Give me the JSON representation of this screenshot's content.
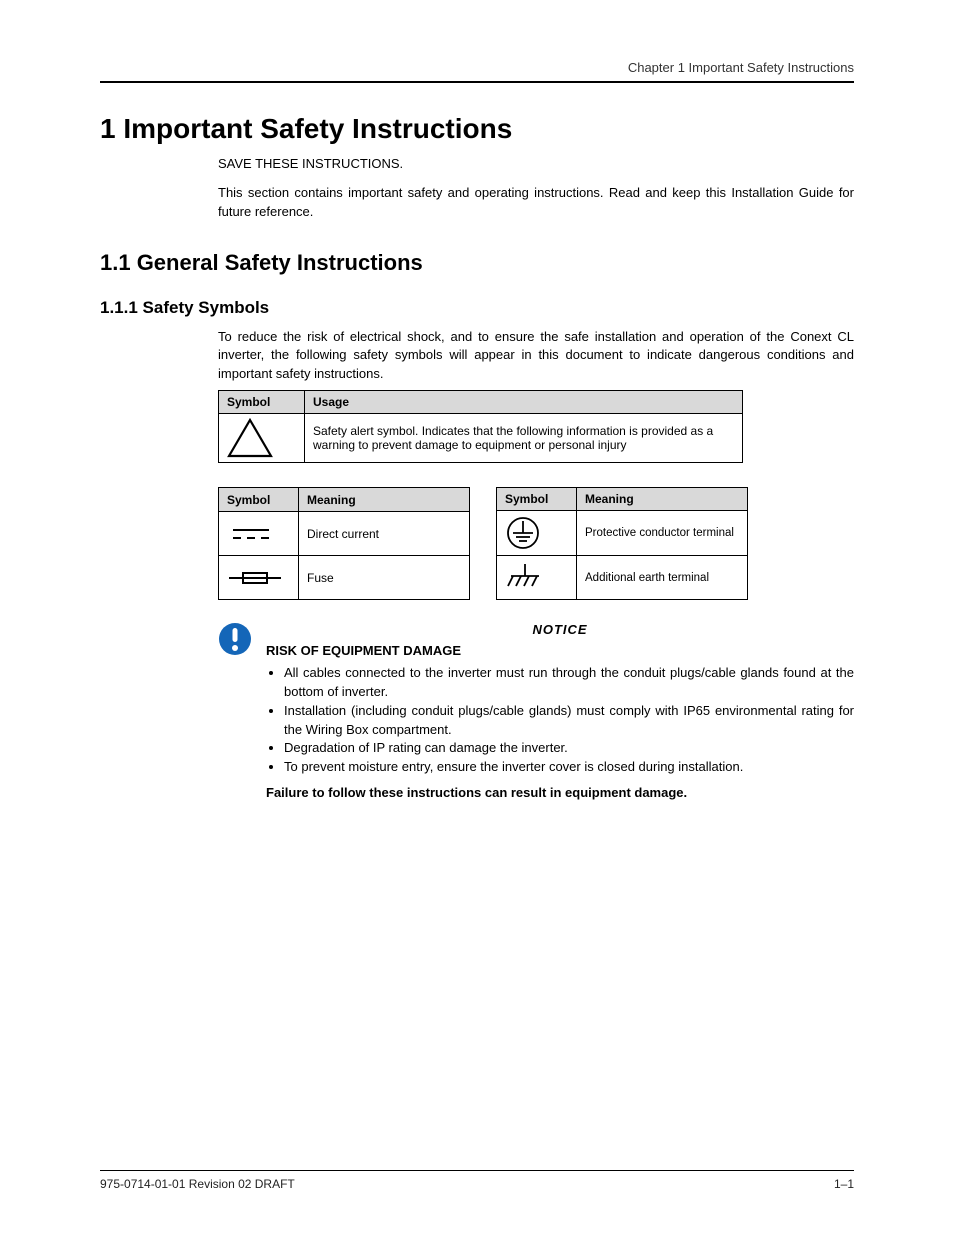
{
  "running_header": "Chapter 1  Important Safety Instructions",
  "chapter_title": "1  Important Safety Instructions",
  "save_line": "SAVE THESE INSTRUCTIONS.",
  "intro_para": "This section contains important safety and operating instructions. Read and keep this Installation Guide for future reference.",
  "h2_general": "1.1  General Safety Instructions",
  "h3_symbols": "1.1.1  Safety Symbols",
  "symbols_intro": "To reduce the risk of electrical shock, and to ensure the safe installation and operation of the Conext CL inverter, the following safety symbols will appear in this document to indicate dangerous conditions and important safety instructions.",
  "table1": {
    "h_symbol": "Symbol",
    "h_usage": "Usage",
    "row1_usage": "Safety alert symbol. Indicates that the following information is provided as a warning to prevent damage to equipment or personal injury"
  },
  "table_left": {
    "h_symbol": "Symbol",
    "h_meaning": "Meaning",
    "r1_sym": "DC",
    "r1_mean": "Direct current",
    "r2_mean": "Fuse"
  },
  "table_right": {
    "h_symbol": "Symbol",
    "h_meaning": "Meaning",
    "r1_mean": "Protective conductor terminal",
    "r2_mean": "Additional earth terminal"
  },
  "notice": {
    "heading": "NOTICE",
    "title": "RISK OF EQUIPMENT DAMAGE",
    "bullet1": "All cables connected to the inverter must run through the conduit plugs/cable glands found at the bottom of inverter.",
    "bullet2": "Installation (including conduit plugs/cable glands) must comply with IP65 environmental rating for the Wiring Box compartment.",
    "bullet3": "Degradation of IP rating can damage the inverter.",
    "bullet4": "To prevent moisture entry, ensure the inverter cover is closed during installation.",
    "footer": "Failure to follow these instructions can result in equipment damage."
  },
  "footer_left": "975-0714-01-01 Revision 02 DRAFT",
  "footer_right": "1–1"
}
